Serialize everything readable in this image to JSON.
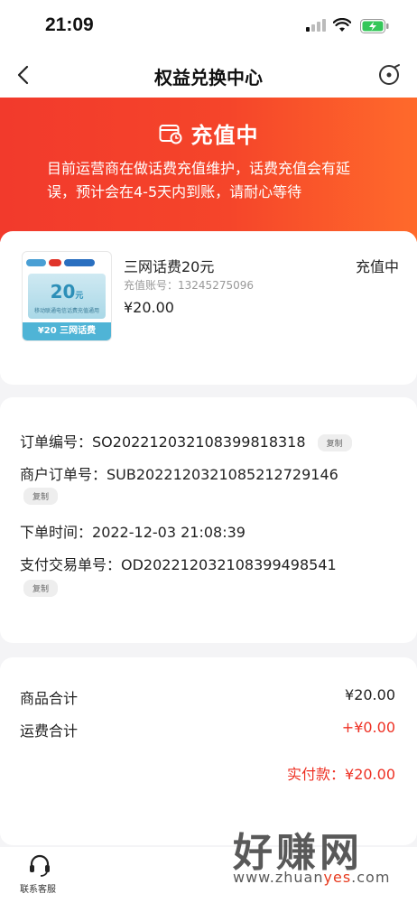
{
  "status_bar": {
    "time": "21:09"
  },
  "nav": {
    "title": "权益兑换中心"
  },
  "header": {
    "status_title": "充值中",
    "description": "目前运营商在做话费充值维护，话费充值会有延误，预计会在4-5天内到账，请耐心等待"
  },
  "product": {
    "thumb_amount": "20",
    "thumb_amount_unit": "元",
    "thumb_sub": "移动联通电信话费充值通用",
    "thumb_bottom": "¥20 三网话费",
    "name": "三网话费20元",
    "status": "充值中",
    "account_label": "充值账号：",
    "account_value": "13245275096",
    "price": "¥20.00"
  },
  "order": {
    "order_no_label": "订单编号：",
    "order_no": "SO20221203210839981831​8",
    "merchant_no_label": "商户订单号：",
    "merchant_no": "SUB20221203210852127291​46",
    "time_label": "下单时间：",
    "time": "2022-12-03 21:08:39",
    "pay_no_label": "支付交易单号：",
    "pay_no": "OD20221203210839949854​1",
    "copy_label": "复制"
  },
  "totals": {
    "goods_label": "商品合计",
    "goods_value": "¥20.00",
    "shipping_label": "运费合计",
    "shipping_value": "+¥0.00",
    "paid_label": "实付款：",
    "paid_value": "¥20.00"
  },
  "bottom": {
    "service_label": "联系客服"
  },
  "watermark": {
    "text": "好赚网",
    "url_a": "www.zhuan",
    "url_b": "yes",
    "url_c": ".com"
  },
  "colors": {
    "accent_red": "#ee3124",
    "header_start": "#f23a2c",
    "header_end": "#ff6a2b"
  }
}
